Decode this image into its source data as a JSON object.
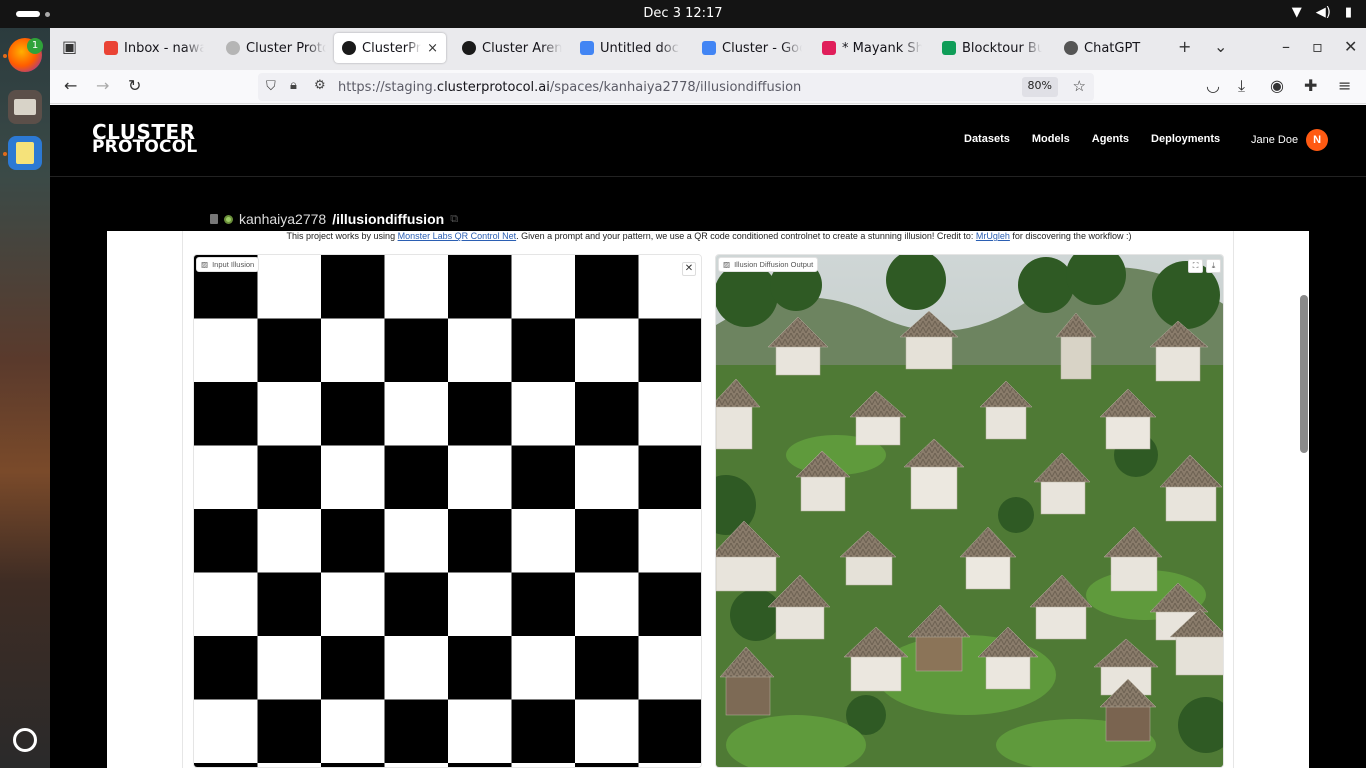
{
  "system": {
    "clock": "Dec 3  12:17",
    "dock_badge": "1"
  },
  "browser": {
    "tabs": [
      {
        "label": "Inbox - nawa",
        "favicon_color": "#ea4335"
      },
      {
        "label": "Cluster Proto",
        "favicon_color": "#b5b5b5"
      },
      {
        "label": "ClusterPro",
        "favicon_color": "#1a1a1a",
        "active": true
      },
      {
        "label": "Cluster Aren",
        "favicon_color": "#1a1a1a"
      },
      {
        "label": "Untitled doc",
        "favicon_color": "#4285f4"
      },
      {
        "label": "Cluster - Goo",
        "favicon_color": "#4285f4"
      },
      {
        "label": "* Mayank Sh",
        "favicon_color": "#e01e5a"
      },
      {
        "label": "Blocktour Bu",
        "favicon_color": "#0f9d58"
      },
      {
        "label": "ChatGPT",
        "favicon_color": "#555555"
      }
    ],
    "tab_close_glyph": "×",
    "new_tab_glyph": "+",
    "url_prefix": "https://staging.",
    "url_host": "clusterprotocol.ai",
    "url_path": "/spaces/kanhaiya2778/illusiondiffusion",
    "zoom": "80%"
  },
  "site": {
    "logo_line1": "CLUSTER",
    "logo_line2": "PROTOCOL",
    "nav": [
      "Datasets",
      "Models",
      "Agents",
      "Deployments"
    ],
    "user_name": "Jane Doe",
    "avatar_initial": "N",
    "accent": "#ff5a12"
  },
  "space": {
    "owner": "kanhaiya2778",
    "repo": "/illusiondiffusion",
    "desc_pre": "This project works by using ",
    "desc_link1": "Monster Labs QR Control Net",
    "desc_mid": ". Given a prompt and your pattern, we use a QR code conditioned controlnet to create a stunning illusion! Credit to: ",
    "desc_link2": "MrUgleh",
    "desc_post": " for discovering the workflow :)",
    "input_label": "Input Illusion",
    "output_label": "Illusion Diffusion Output"
  }
}
